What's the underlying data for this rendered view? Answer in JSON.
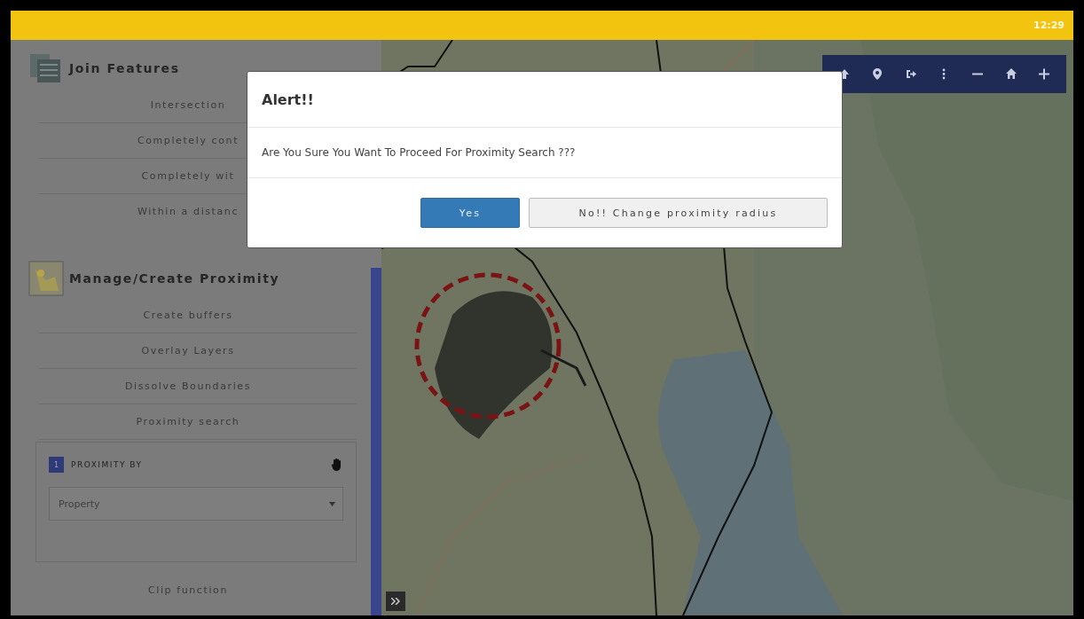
{
  "status_bar": {
    "time": "12:29"
  },
  "sidebar": {
    "sections": [
      {
        "title": "Join Features",
        "kind": "join",
        "items": [
          {
            "label": "Intersection"
          },
          {
            "label": "Completely cont"
          },
          {
            "label": "Completely wit"
          },
          {
            "label": "Within a distanc"
          }
        ]
      },
      {
        "title": "Manage/Create Proximity",
        "kind": "proximity",
        "items": [
          {
            "label": "Create buffers"
          },
          {
            "label": "Overlay Layers"
          },
          {
            "label": "Dissolve Boundaries"
          },
          {
            "label": "Proximity search",
            "panel": {
              "step": "1",
              "label": "PROXIMITY BY",
              "select": {
                "value": "Property"
              }
            }
          },
          {
            "label": "Clip function"
          }
        ]
      }
    ]
  },
  "dialog": {
    "title": "Alert!!",
    "message": "Are You Sure You Want To Proceed For Proximity Search ???",
    "buttons": [
      {
        "label": "Yes",
        "kind": "primary"
      },
      {
        "label": "No!! Change proximity radius",
        "kind": "default"
      }
    ]
  }
}
